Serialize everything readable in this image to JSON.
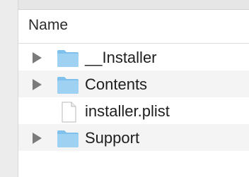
{
  "header": {
    "column_name": "Name"
  },
  "rows": [
    {
      "label": "__Installer",
      "kind": "folder",
      "expandable": true
    },
    {
      "label": "Contents",
      "kind": "folder",
      "expandable": true
    },
    {
      "label": "installer.plist",
      "kind": "file",
      "expandable": false
    },
    {
      "label": "Support",
      "kind": "folder",
      "expandable": true
    }
  ],
  "colors": {
    "folder_fill": "#9fd2f2",
    "folder_tab": "#7fc1ec",
    "stripe": "#f4f4f5"
  }
}
